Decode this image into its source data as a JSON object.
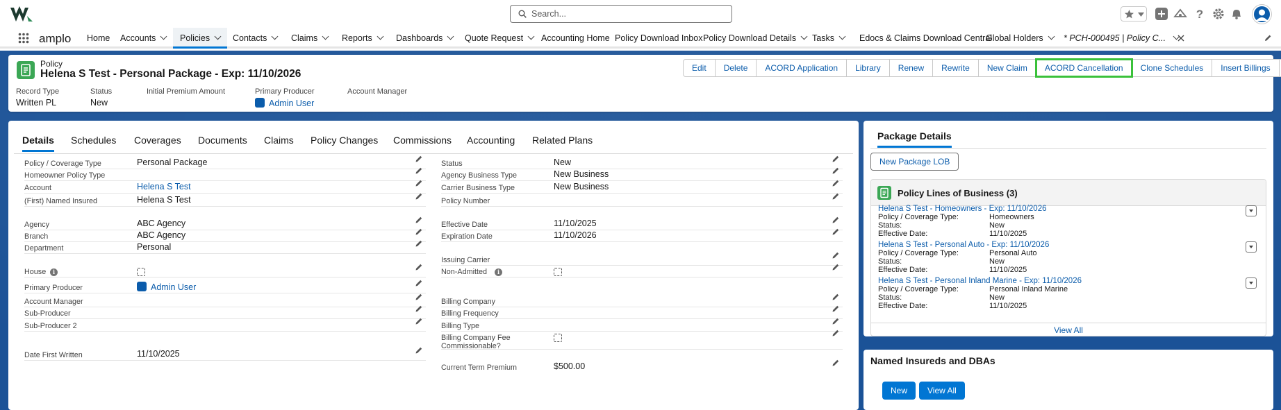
{
  "header": {
    "search_placeholder": "Search...",
    "icons": [
      "favorites-icon",
      "global-actions-icon",
      "trailhead-icon",
      "help-icon",
      "setup-gear-icon",
      "notifications-icon",
      "avatar"
    ]
  },
  "nav": {
    "app_name": "amplo",
    "items": [
      {
        "label": "Home",
        "chevron": false
      },
      {
        "label": "Accounts",
        "chevron": true
      },
      {
        "label": "Policies",
        "chevron": true,
        "active": true
      },
      {
        "label": "Contacts",
        "chevron": true
      },
      {
        "label": "Claims",
        "chevron": true
      },
      {
        "label": "Reports",
        "chevron": true
      },
      {
        "label": "Dashboards",
        "chevron": true
      },
      {
        "label": "Quote Request",
        "chevron": true
      },
      {
        "label": "Accounting Home",
        "chevron": false
      },
      {
        "label": "Policy Download Inbox",
        "chevron": false
      },
      {
        "label": "Policy Download Details",
        "chevron": true
      },
      {
        "label": "Tasks",
        "chevron": true
      },
      {
        "label": "Edocs & Claims Download Central",
        "chevron": false
      },
      {
        "label": "Global Holders",
        "chevron": true
      }
    ],
    "open_tab": "* PCH-000495 | Policy C..."
  },
  "record": {
    "object": "Policy",
    "title": "Helena S Test - Personal Package - Exp: 11/10/2026",
    "actions": [
      "Edit",
      "Delete",
      "ACORD Application",
      "Library",
      "Renew",
      "Rewrite",
      "New Claim",
      "ACORD Cancellation",
      "Clone Schedules",
      "Insert Billings"
    ],
    "highlighted_action": "ACORD Cancellation",
    "highlights": [
      {
        "label": "Record Type",
        "value": "Written PL"
      },
      {
        "label": "Status",
        "value": "New"
      },
      {
        "label": "Initial Premium Amount",
        "value": ""
      },
      {
        "label": "Primary Producer",
        "value": "Admin User"
      },
      {
        "label": "Account Manager",
        "value": ""
      }
    ]
  },
  "tabs": [
    "Details",
    "Schedules",
    "Coverages",
    "Documents",
    "Claims",
    "Policy Changes",
    "Commissions",
    "Accounting",
    "Related Plans"
  ],
  "details": {
    "left": [
      {
        "label": "Policy / Coverage Type",
        "value": "Personal Package"
      },
      {
        "label": "Homeowner Policy Type",
        "value": ""
      },
      {
        "label": "Account",
        "value": "Helena S Test",
        "link": true
      },
      {
        "label": "(First) Named Insured",
        "value": "Helena S Test"
      },
      {
        "label": "Agency",
        "value": "ABC Agency"
      },
      {
        "label": "Branch",
        "value": "ABC Agency"
      },
      {
        "label": "Department",
        "value": "Personal"
      },
      {
        "label": "House",
        "value": ""
      },
      {
        "label": "Primary Producer",
        "value": "Admin User",
        "link": true
      },
      {
        "label": "Account Manager",
        "value": ""
      },
      {
        "label": "Sub-Producer",
        "value": ""
      },
      {
        "label": "Sub-Producer 2",
        "value": ""
      },
      {
        "label": "Date First Written",
        "value": "11/10/2025"
      }
    ],
    "right": [
      {
        "label": "Status",
        "value": "New"
      },
      {
        "label": "Agency Business Type",
        "value": "New Business"
      },
      {
        "label": "Carrier Business Type",
        "value": "New Business"
      },
      {
        "label": "Policy Number",
        "value": ""
      },
      {
        "label": "Effective Date",
        "value": "11/10/2025"
      },
      {
        "label": "Expiration Date",
        "value": "11/10/2026"
      },
      {
        "label": "Issuing Carrier",
        "value": ""
      },
      {
        "label": "Non-Admitted",
        "value": ""
      },
      {
        "label": "Billing Company",
        "value": ""
      },
      {
        "label": "Billing Frequency",
        "value": ""
      },
      {
        "label": "Billing Type",
        "value": ""
      },
      {
        "label": "Billing Company Fee Commissionable?",
        "value": ""
      },
      {
        "label": "Current Term Premium",
        "value": "$500.00"
      }
    ]
  },
  "package": {
    "tab": "Package Details",
    "new_lob": "New Package LOB",
    "lines_title": "Policy Lines of Business (3)",
    "lines": [
      {
        "name": "Helena S Test - Homeowners - Exp: 11/10/2026",
        "type_label": "Policy / Coverage Type:",
        "type": "Homeowners",
        "status_label": "Status:",
        "status": "New",
        "eff_label": "Effective Date:",
        "eff": "11/10/2025"
      },
      {
        "name": "Helena S Test - Personal Auto - Exp: 11/10/2026",
        "type_label": "Policy / Coverage Type:",
        "type": "Personal Auto",
        "status_label": "Status:",
        "status": "New",
        "eff_label": "Effective Date:",
        "eff": "11/10/2025"
      },
      {
        "name": "Helena S Test - Personal Inland Marine - Exp: 11/10/2026",
        "type_label": "Policy / Coverage Type:",
        "type": "Personal Inland Marine",
        "status_label": "Status:",
        "status": "New",
        "eff_label": "Effective Date:",
        "eff": "11/10/2025"
      }
    ],
    "view_all": "View All"
  },
  "named_insureds": {
    "title": "Named Insureds and DBAs",
    "new": "New",
    "view_all": "View All"
  },
  "colors": {
    "brand": "#0176d3",
    "link": "#0b5cab",
    "record_icon": "#3ba755",
    "highlight": "#3ac13a",
    "background": "#1b5297"
  }
}
